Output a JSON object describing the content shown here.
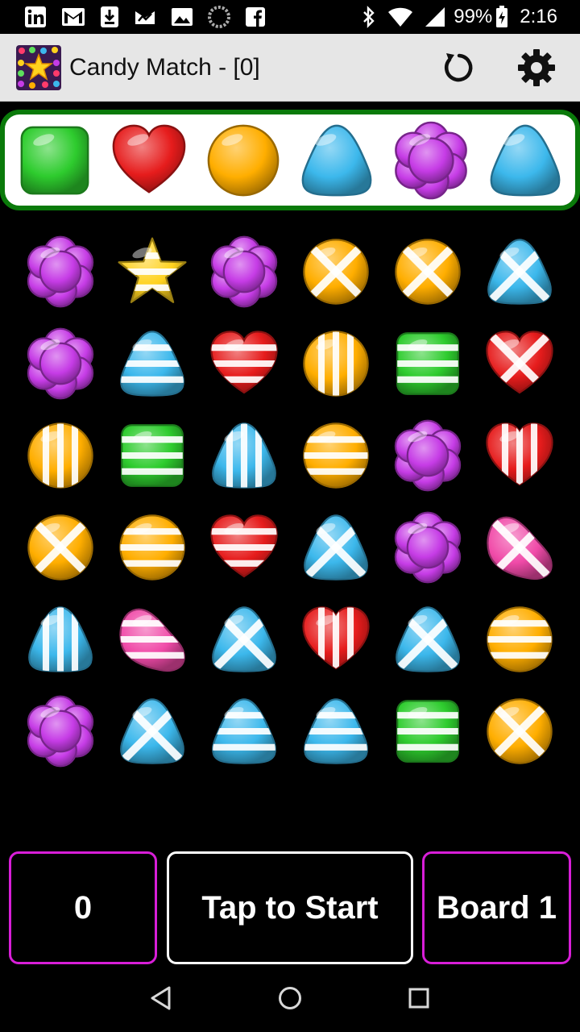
{
  "status_bar": {
    "battery_text": "99%",
    "time": "2:16",
    "left_icons": [
      "linkedin-icon",
      "gmail-icon",
      "download-icon",
      "activity-icon",
      "photos-icon",
      "loading-icon",
      "facebook-icon"
    ],
    "right_icons": [
      "bluetooth-icon",
      "wifi-icon",
      "signal-icon",
      "battery-icon"
    ]
  },
  "app_bar": {
    "title": "Candy Match - [0]",
    "actions": [
      "refresh-icon",
      "gear-icon"
    ]
  },
  "colors": {
    "strip_border": "#0a7a0a",
    "accent_magenta": "#d81ed8",
    "green": "#2ecc2e",
    "red": "#e61c1c",
    "orange": "#ffae00",
    "blue": "#3cb8ec",
    "purple": "#c63ce6",
    "pink": "#f04aa8",
    "yellow": "#ffd21e"
  },
  "target_candies": [
    {
      "shape": "square",
      "color": "green"
    },
    {
      "shape": "heart",
      "color": "red"
    },
    {
      "shape": "circle",
      "color": "orange"
    },
    {
      "shape": "drop",
      "color": "blue"
    },
    {
      "shape": "flower",
      "color": "purple"
    },
    {
      "shape": "drop",
      "color": "blue"
    }
  ],
  "board": [
    [
      {
        "shape": "flower",
        "color": "purple",
        "pattern": "h"
      },
      {
        "shape": "star",
        "color": "yellow",
        "pattern": "h"
      },
      {
        "shape": "flower",
        "color": "purple",
        "pattern": "h"
      },
      {
        "shape": "circle",
        "color": "orange",
        "pattern": "x"
      },
      {
        "shape": "circle",
        "color": "orange",
        "pattern": "x"
      },
      {
        "shape": "drop",
        "color": "blue",
        "pattern": "x"
      }
    ],
    [
      {
        "shape": "flower",
        "color": "purple",
        "pattern": "v"
      },
      {
        "shape": "drop",
        "color": "blue",
        "pattern": "h"
      },
      {
        "shape": "heart",
        "color": "red",
        "pattern": "h"
      },
      {
        "shape": "circle",
        "color": "orange",
        "pattern": "v"
      },
      {
        "shape": "square",
        "color": "green",
        "pattern": "h"
      },
      {
        "shape": "heart",
        "color": "red",
        "pattern": "x"
      }
    ],
    [
      {
        "shape": "circle",
        "color": "orange",
        "pattern": "v"
      },
      {
        "shape": "square",
        "color": "green",
        "pattern": "h"
      },
      {
        "shape": "drop",
        "color": "blue",
        "pattern": "v"
      },
      {
        "shape": "circle",
        "color": "orange",
        "pattern": "h"
      },
      {
        "shape": "flower",
        "color": "purple",
        "pattern": "v"
      },
      {
        "shape": "heart",
        "color": "red",
        "pattern": "v"
      }
    ],
    [
      {
        "shape": "circle",
        "color": "orange",
        "pattern": "x"
      },
      {
        "shape": "circle",
        "color": "orange",
        "pattern": "h"
      },
      {
        "shape": "heart",
        "color": "red",
        "pattern": "h"
      },
      {
        "shape": "drop",
        "color": "blue",
        "pattern": "x"
      },
      {
        "shape": "flower",
        "color": "purple",
        "pattern": "h"
      },
      {
        "shape": "bean",
        "color": "pink",
        "pattern": "x"
      }
    ],
    [
      {
        "shape": "drop",
        "color": "blue",
        "pattern": "v"
      },
      {
        "shape": "bean",
        "color": "pink",
        "pattern": "h"
      },
      {
        "shape": "drop",
        "color": "blue",
        "pattern": "x"
      },
      {
        "shape": "heart",
        "color": "red",
        "pattern": "v"
      },
      {
        "shape": "drop",
        "color": "blue",
        "pattern": "x"
      },
      {
        "shape": "circle",
        "color": "orange",
        "pattern": "h"
      }
    ],
    [
      {
        "shape": "flower",
        "color": "purple",
        "pattern": "x"
      },
      {
        "shape": "drop",
        "color": "blue",
        "pattern": "x"
      },
      {
        "shape": "drop",
        "color": "blue",
        "pattern": "h"
      },
      {
        "shape": "drop",
        "color": "blue",
        "pattern": "h"
      },
      {
        "shape": "square",
        "color": "green",
        "pattern": "h"
      },
      {
        "shape": "circle",
        "color": "orange",
        "pattern": "x"
      }
    ]
  ],
  "bottom": {
    "score": "0",
    "start_label": "Tap to Start",
    "board_label": "Board 1"
  },
  "nav": [
    "back-icon",
    "home-icon",
    "recents-icon"
  ]
}
